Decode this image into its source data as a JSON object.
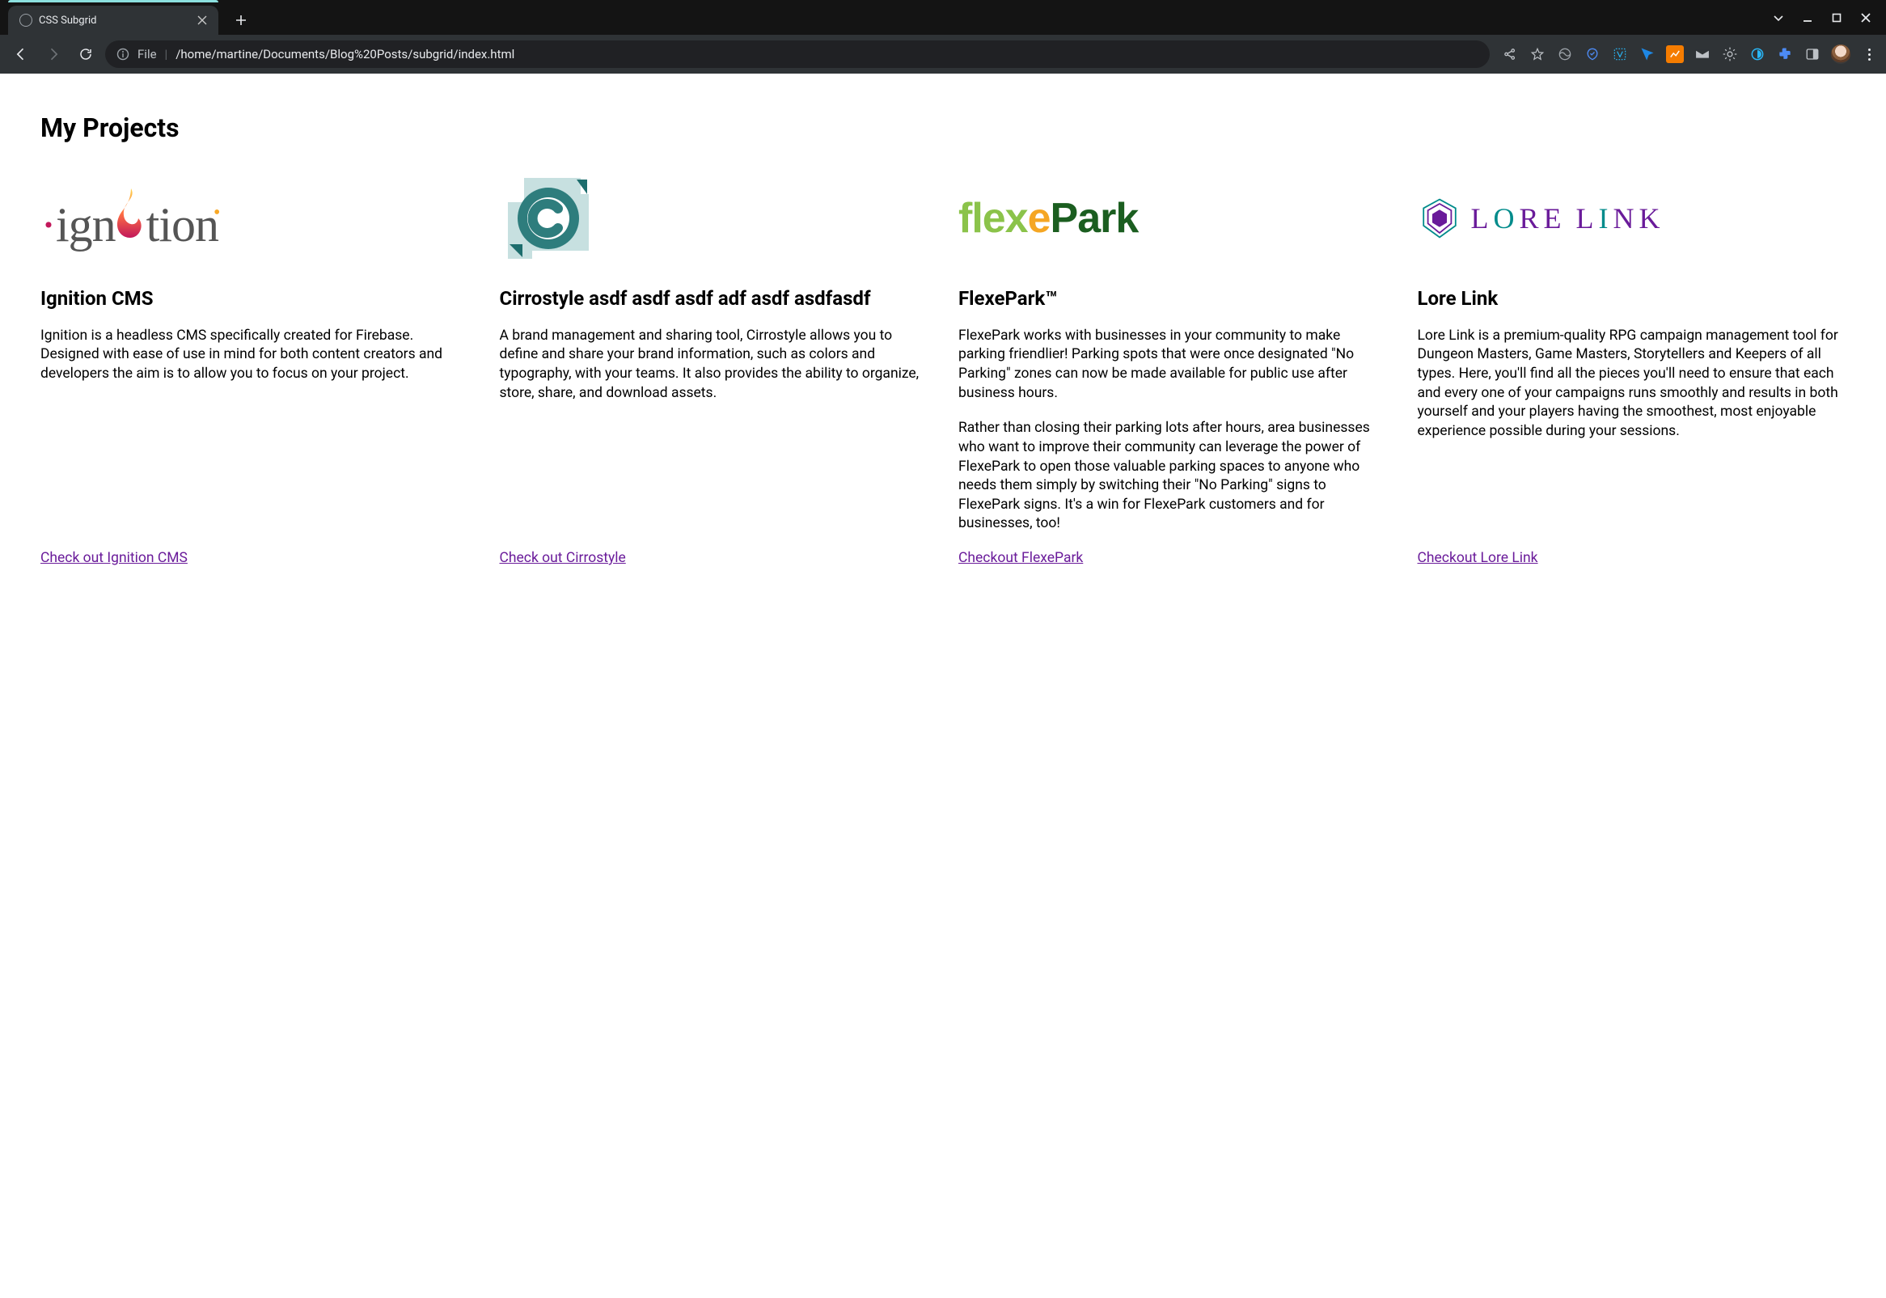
{
  "browser": {
    "tab_title": "CSS Subgrid",
    "url_scheme": "File",
    "url_path": "/home/martine/Documents/Blog%20Posts/subgrid/index.html"
  },
  "page": {
    "heading": "My Projects"
  },
  "projects": [
    {
      "title": "Ignition CMS",
      "desc1": "Ignition is a headless CMS specifically created for Firebase. Designed with ease of use in mind for both content creators and developers the aim is to allow you to focus on your project.",
      "desc2": "",
      "cta": "Check out Ignition CMS"
    },
    {
      "title": "Cirrostyle asdf asdf asdf adf asdf asdfasdf",
      "desc1": "A brand management and sharing tool, Cirrostyle allows you to define and share your brand information, such as colors and typography, with your teams. It also provides the ability to organize, store, share, and download assets.",
      "desc2": "",
      "cta": "Check out Cirrostyle"
    },
    {
      "title": "FlexePark™",
      "desc1": "FlexePark works with businesses in your community to make parking friendlier! Parking spots that were once designated \"No Parking\" zones can now be made available for public use after business hours.",
      "desc2": "Rather than closing their parking lots after hours, area businesses who want to improve their community can leverage the power of FlexePark to open those valuable parking spaces to anyone who needs them simply by switching their \"No Parking\" signs to FlexePark signs. It's a win for FlexePark customers and for businesses, too!",
      "cta": "Checkout FlexePark"
    },
    {
      "title": "Lore Link",
      "desc1": "Lore Link is a premium-quality RPG campaign management tool for Dungeon Masters, Game Masters, Storytellers and Keepers of all types. Here, you'll find all the pieces you'll need to ensure that each and every one of your campaigns runs smoothly and results in both yourself and your players having the smoothest, most enjoyable experience possible during your sessions.",
      "desc2": "",
      "cta": "Checkout Lore Link"
    }
  ]
}
